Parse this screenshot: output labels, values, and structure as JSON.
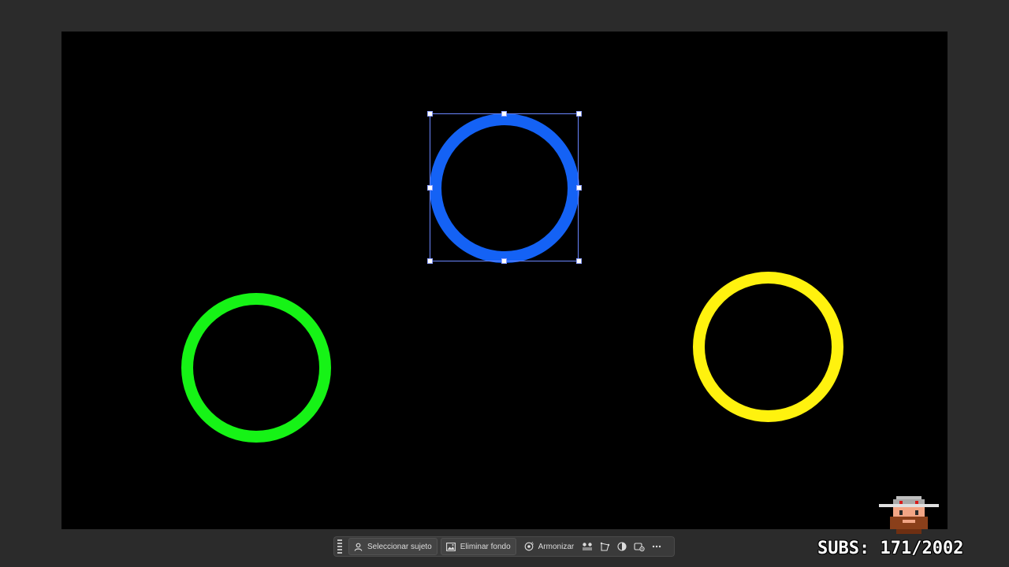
{
  "canvas": {
    "background": "#000000",
    "shapes": [
      {
        "name": "circle-blue",
        "color": "#1462f5",
        "selected": true
      },
      {
        "name": "circle-green",
        "color": "#16f316",
        "selected": false
      },
      {
        "name": "circle-yellow",
        "color": "#fff20e",
        "selected": false
      }
    ]
  },
  "taskbar": {
    "select_subject": {
      "label": "Seleccionar sujeto",
      "icon": "person-icon"
    },
    "remove_background": {
      "label": "Eliminar fondo",
      "icon": "image-icon"
    },
    "harmonize": {
      "label": "Armonizar",
      "icon": "harmonize-icon"
    },
    "icon_buttons": [
      "adjust-icon",
      "transform-icon",
      "contrast-icon",
      "settings-icon",
      "more-icon"
    ]
  },
  "overlay": {
    "subs_label": "SUBS: 171/2002"
  },
  "colors": {
    "app_background": "#2b2b2b",
    "selection": "#6a86ff"
  }
}
